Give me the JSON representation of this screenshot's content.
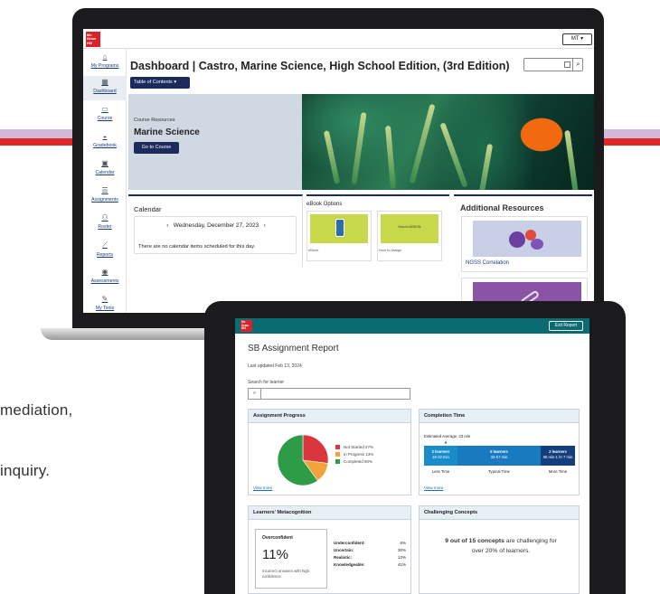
{
  "background": {
    "text_line1": "mediation,",
    "text_line2": "inquiry."
  },
  "laptop": {
    "logo": [
      "Mc",
      "Graw",
      "Hill"
    ],
    "user_initials": "MT",
    "sidebar": [
      {
        "label": "My Programs",
        "icon": "home-icon"
      },
      {
        "label": "Dashboard",
        "icon": "grid-icon"
      },
      {
        "label": "Course",
        "icon": "book-icon"
      },
      {
        "label": "Gradebook",
        "icon": "gradebook-icon"
      },
      {
        "label": "Calendar",
        "icon": "calendar-icon"
      },
      {
        "label": "Assignments",
        "icon": "list-icon"
      },
      {
        "label": "Roster",
        "icon": "users-icon"
      },
      {
        "label": "Reports",
        "icon": "chart-icon"
      },
      {
        "label": "Assessments",
        "icon": "assessment-icon"
      },
      {
        "label": "My Tools",
        "icon": "tools-icon"
      }
    ],
    "page_title": "Dashboard | Castro, Marine Science, High School Edition, (3rd Edition)",
    "toc_label": "Table of Contents",
    "banner": {
      "subtitle": "Course Resources",
      "title": "Marine Science",
      "button": "Go to Course"
    },
    "calendar": {
      "title": "Calendar",
      "date": "Wednesday, December 27, 2023",
      "empty": "There are no calendar items scheduled for this day."
    },
    "ebook": {
      "title": "eBook Options",
      "cards": [
        {
          "label": "eBook",
          "image_text": ""
        },
        {
          "label": "How to Assign",
          "image_text": "How to ASSIGN"
        }
      ]
    },
    "additional": {
      "title": "Additional Resources",
      "ngss_label": "NGSS Correlation"
    }
  },
  "tablet": {
    "logo": [
      "Mc",
      "Graw",
      "Hill"
    ],
    "exit_label": "Exit Report",
    "title": "SB Assignment Report",
    "updated": "Last updated Feb 13, 2024",
    "search_label": "Search for learner",
    "progress": {
      "title": "Assignment Progress",
      "link": "View more",
      "legend": [
        {
          "label": "Not Started 27%",
          "color": "#d9363e"
        },
        {
          "label": "In Progress 13%",
          "color": "#f2a33a"
        },
        {
          "label": "Completed 60%",
          "color": "#2e9b47"
        }
      ]
    },
    "completion": {
      "title": "Completion Time",
      "estimated": "Estimated Average: 23 min",
      "segments": [
        {
          "top": "2 learners",
          "bottom": "16-32 min",
          "caption": "Less Time",
          "color": "#1a8ccb"
        },
        {
          "top": "5 learners",
          "bottom": "33-57 min",
          "caption": "Typical Time",
          "color": "#1a7ac0"
        },
        {
          "top": "2 learners",
          "bottom": "58 min-1 hr 7 min",
          "caption": "More Time",
          "color": "#123f7c"
        }
      ],
      "link": "View more"
    },
    "metacognition": {
      "title": "Learners' Metacognition",
      "box_title": "Overconfident",
      "box_value": "11%",
      "box_desc": "Incorrect answers with high confidence",
      "rows": [
        {
          "label": "Underconfident:",
          "value": "6%"
        },
        {
          "label": "Uncertain:",
          "value": "30%"
        },
        {
          "label": "Realistic:",
          "value": "12%"
        },
        {
          "label": "Knowledgeable:",
          "value": "41%"
        }
      ]
    },
    "concepts": {
      "title": "Challenging Concepts",
      "bold": "9 out of 15 concepts",
      "rest": " are challenging for over 20% of learners."
    }
  },
  "chart_data": {
    "type": "pie",
    "categories": [
      "Not Started",
      "In Progress",
      "Completed"
    ],
    "values": [
      27,
      13,
      60
    ],
    "colors": [
      "#d9363e",
      "#f2a33a",
      "#2e9b47"
    ]
  }
}
